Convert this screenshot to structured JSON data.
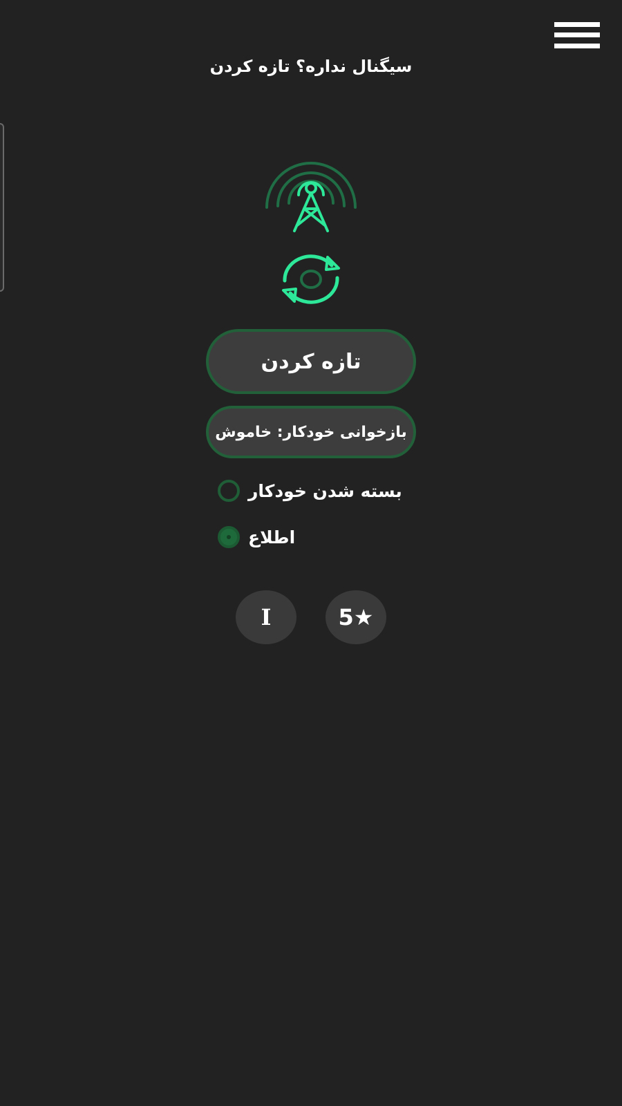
{
  "header": {
    "menu_icon": "hamburger-menu-icon",
    "hint_text": "سیگنال نداره؟ تازه کردن"
  },
  "icons": {
    "tower": "signal-tower-icon",
    "refresh": "refresh-icon",
    "accent_color": "#2ee89a",
    "dim_color": "#1f6e45"
  },
  "actions": {
    "refresh_label": "تازه کردن",
    "auto_reload_label": "بازخوانی خودکار: خاموش"
  },
  "options": [
    {
      "label": "بسته شدن خودکار",
      "checked": false
    },
    {
      "label": "اطلاع",
      "checked": true
    }
  ],
  "footer": {
    "info_label": "I",
    "rate_label": "5★"
  },
  "colors": {
    "background": "#222222",
    "button_bg": "#3d3d3d",
    "button_border": "#22603a"
  }
}
